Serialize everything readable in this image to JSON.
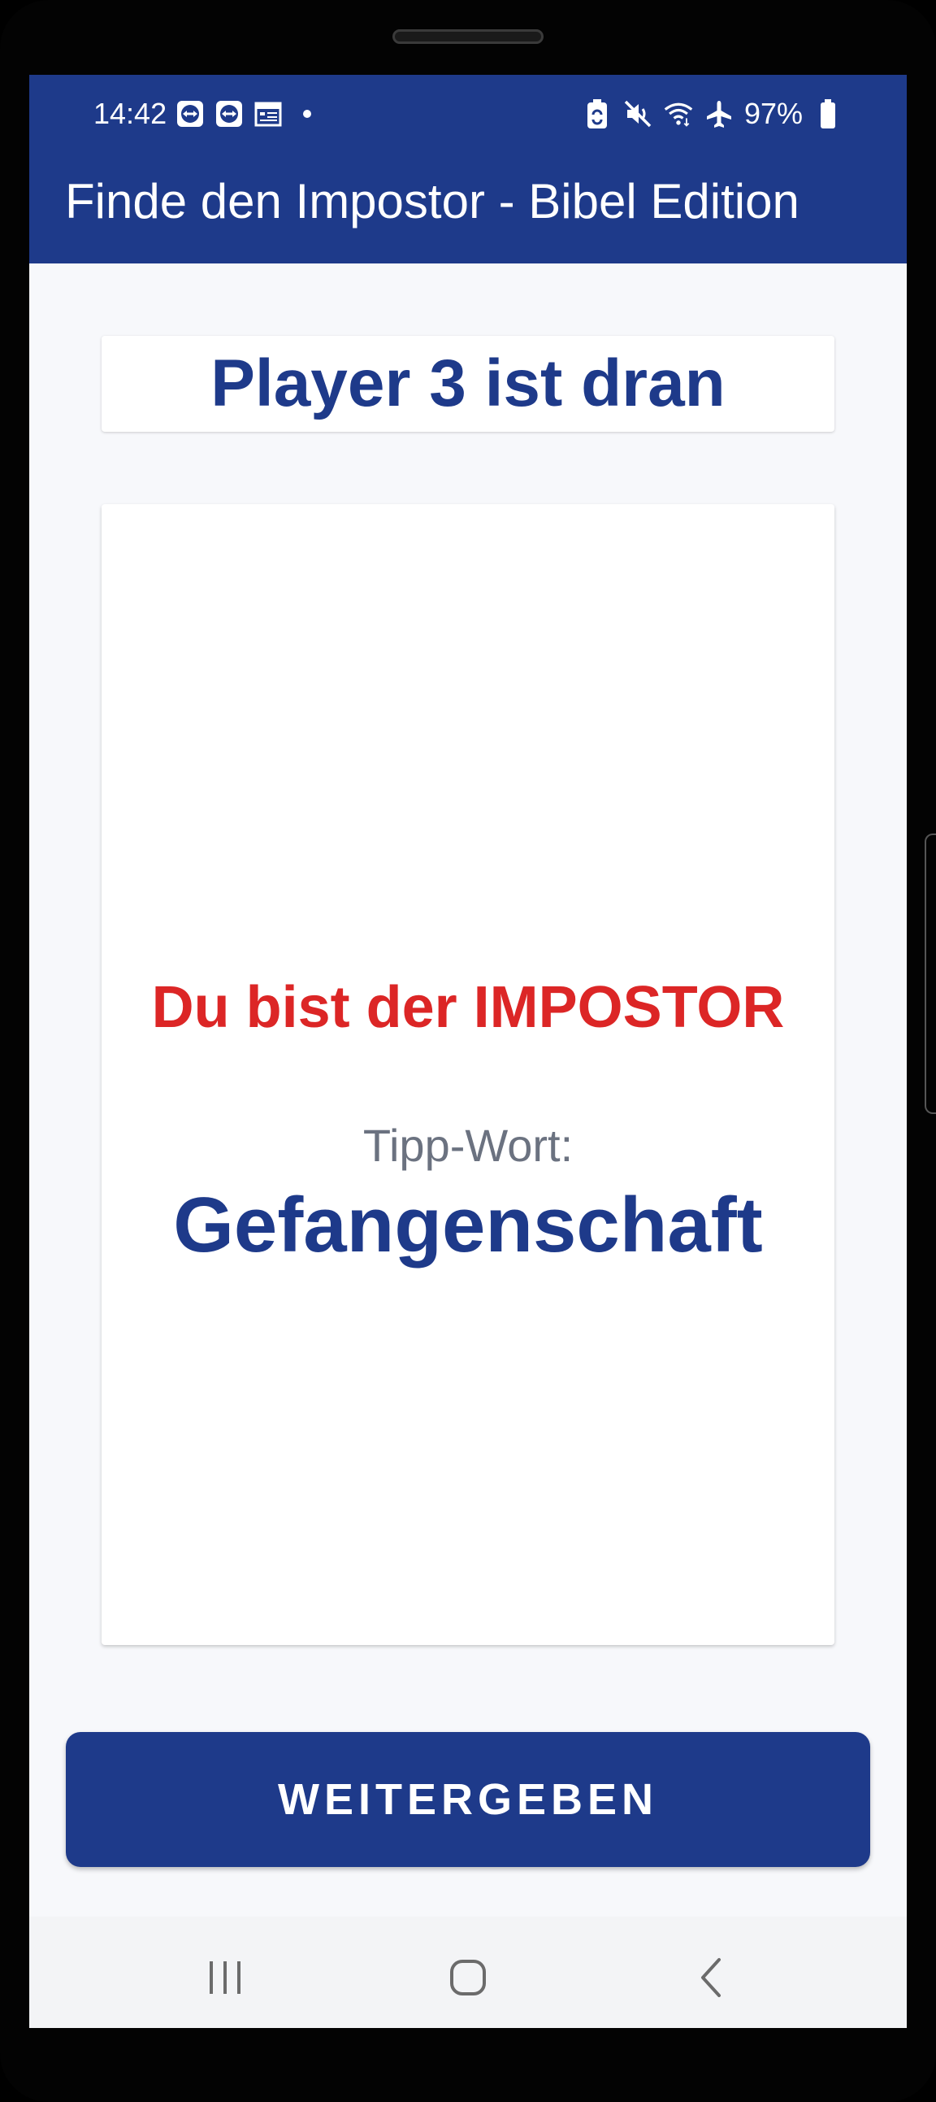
{
  "status_bar": {
    "time": "14:42",
    "left_icons": [
      "teamviewer-icon",
      "teamviewer-icon",
      "calendar-icon",
      "dot-icon"
    ],
    "right_icons": [
      "battery-saver-icon",
      "mute-icon",
      "wifi-icon",
      "airplane-icon"
    ],
    "battery": "97%"
  },
  "app_bar": {
    "title": "Finde den Impostor - Bibel Edition",
    "color": "#1e3a8a"
  },
  "main": {
    "player_turn": "Player 3 ist dran",
    "role_text": "Du bist der IMPOSTOR",
    "hint_label": "Tipp-Wort:",
    "hint_word": "Gefangenschaft",
    "pass_button": "WEITERGEBEN",
    "role_color": "#dc2626"
  },
  "nav_bar": {
    "buttons": [
      "recents-icon",
      "home-icon",
      "back-icon"
    ]
  }
}
